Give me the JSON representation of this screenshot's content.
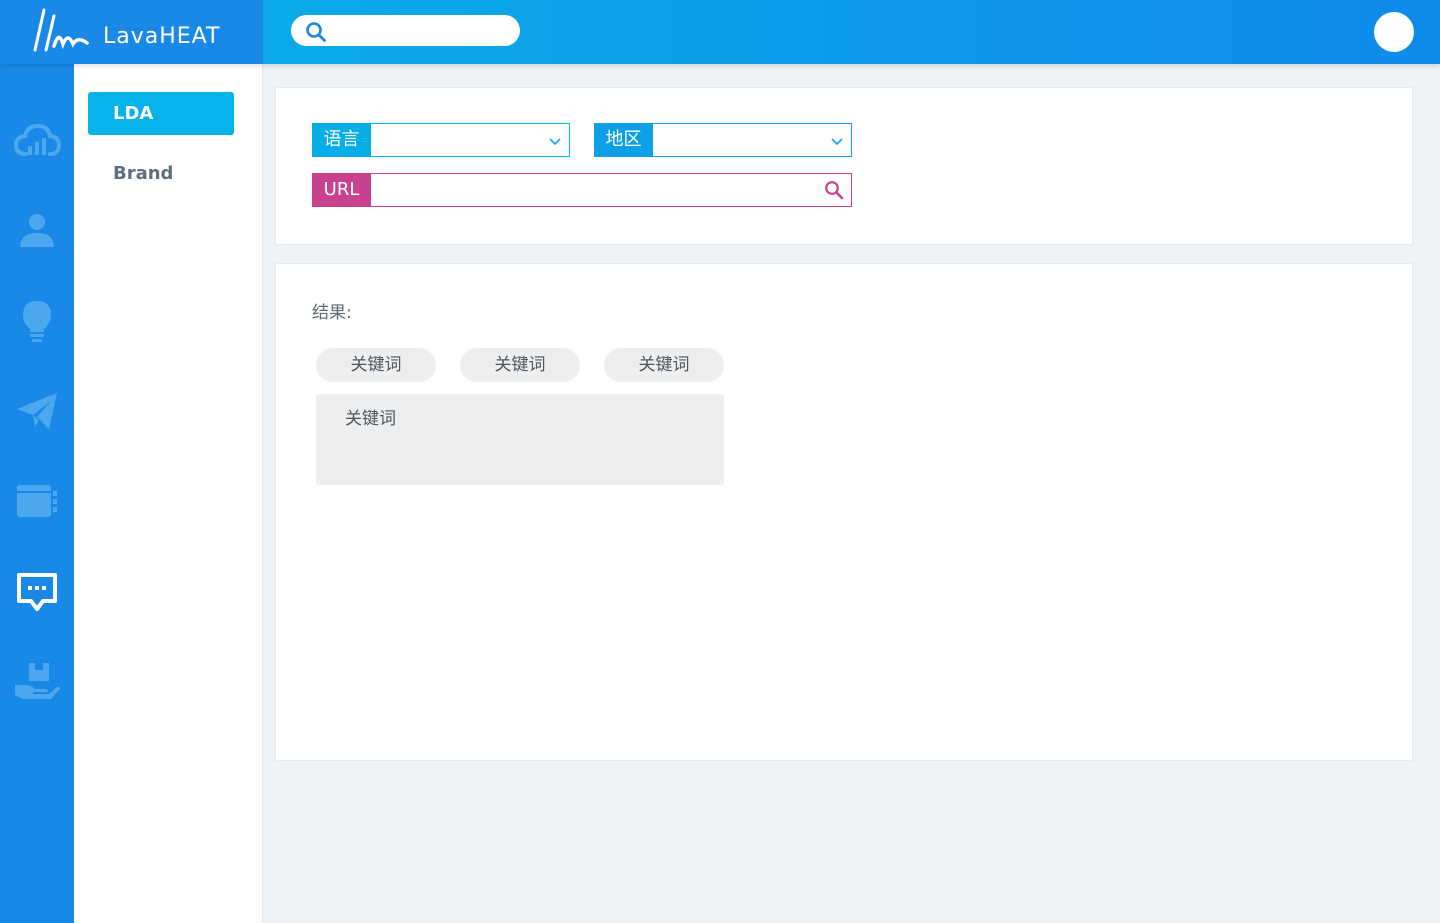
{
  "app": {
    "name": "LavaHEAT"
  },
  "header": {
    "search_placeholder": ""
  },
  "rail": {
    "items": [
      {
        "icon": "cloud-chart-icon",
        "active": false
      },
      {
        "icon": "user-icon",
        "active": false
      },
      {
        "icon": "lightbulb-icon",
        "active": false
      },
      {
        "icon": "paper-plane-icon",
        "active": false
      },
      {
        "icon": "browser-window-icon",
        "active": false
      },
      {
        "icon": "chat-bubble-icon",
        "active": true
      },
      {
        "icon": "hand-box-icon",
        "active": false
      }
    ]
  },
  "subnav": {
    "items": [
      {
        "label": "LDA",
        "active": true
      },
      {
        "label": "Brand",
        "active": false
      }
    ]
  },
  "filters": {
    "language_label": "语言",
    "language_value": "",
    "region_label": "地区",
    "region_value": "",
    "url_label": "URL",
    "url_value": ""
  },
  "results": {
    "label": "结果:",
    "chips": [
      "关键词",
      "关键词",
      "关键词"
    ],
    "box_text": "关键词"
  },
  "colors": {
    "brand_blue": "#1a88e6",
    "accent_cyan": "#06b2ea",
    "url_magenta": "#c9428f"
  }
}
